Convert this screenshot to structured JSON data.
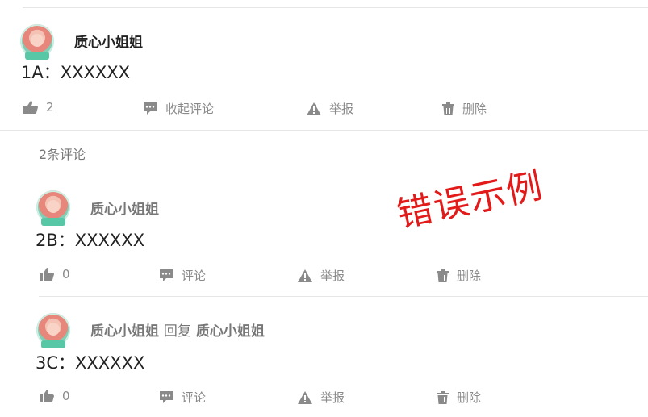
{
  "comments": [
    {
      "name": "质心小姐姐",
      "content": "1A：XXXXXX",
      "likes": "2",
      "comment_action": "收起评论",
      "report": "举报",
      "delete": "删除"
    }
  ],
  "replies_header": "2条评论",
  "replies": [
    {
      "name": "质心小姐姐",
      "content": "2B：XXXXXX",
      "likes": "0",
      "comment_action": "评论",
      "report": "举报",
      "delete": "删除"
    },
    {
      "name": "质心小姐姐",
      "reply_word": "回复",
      "reply_to": "质心小姐姐",
      "content": "3C：XXXXXX",
      "likes": "0",
      "comment_action": "评论",
      "report": "举报",
      "delete": "删除"
    }
  ],
  "stamp_text": "错误示例",
  "colors": {
    "stamp": "#e21a1a",
    "action": "#8a8a8a"
  },
  "icons": [
    "thumbs-up-icon",
    "comment-icon",
    "warning-icon",
    "trash-icon"
  ]
}
